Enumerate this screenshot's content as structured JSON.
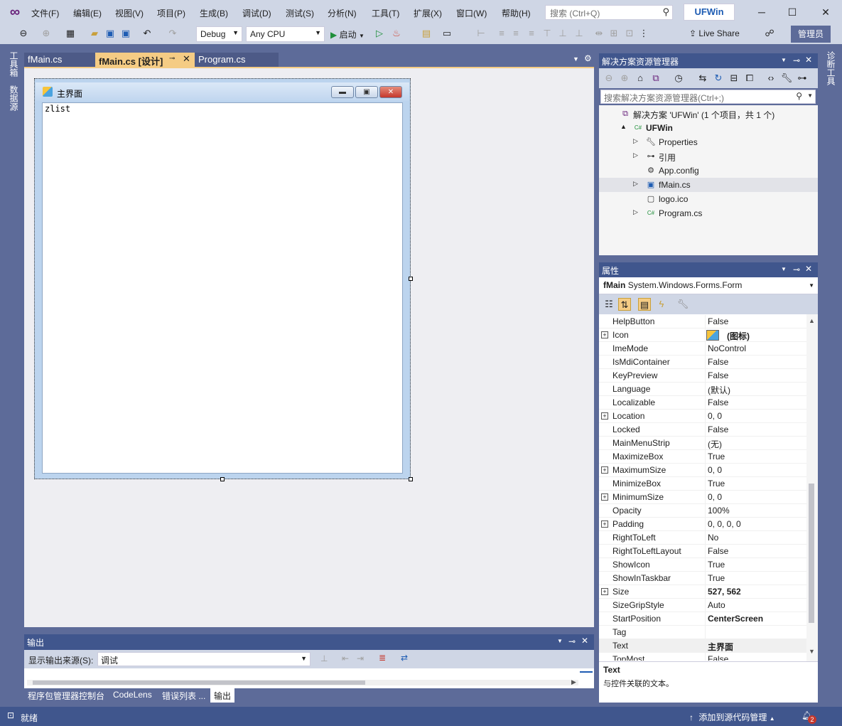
{
  "menu": {
    "items": [
      "文件(F)",
      "编辑(E)",
      "视图(V)",
      "项目(P)",
      "生成(B)",
      "调试(D)",
      "测试(S)",
      "分析(N)",
      "工具(T)",
      "扩展(X)",
      "窗口(W)",
      "帮助(H)"
    ],
    "search_placeholder": "搜索 (Ctrl+Q)",
    "app_title": "UFWin"
  },
  "toolbar": {
    "config": "Debug",
    "platform": "Any CPU",
    "start_label": "启动",
    "live_share": "Live Share",
    "admin": "管理员"
  },
  "left_rail": {
    "toolbox": "工具箱",
    "datasource": "数据源"
  },
  "right_rail": {
    "diagnostics": "诊断工具"
  },
  "doc_tabs": [
    {
      "label": "fMain.cs",
      "active": false
    },
    {
      "label": "fMain.cs [设计]",
      "active": true
    },
    {
      "label": "Program.cs",
      "active": false
    }
  ],
  "designer": {
    "form_title": "主界面",
    "control_text": "zlist"
  },
  "output": {
    "title": "输出",
    "source_label": "显示输出来源(S):",
    "source_value": "调试"
  },
  "bottom_tabs": [
    {
      "label": "程序包管理器控制台",
      "active": false
    },
    {
      "label": "CodeLens",
      "active": false
    },
    {
      "label": "错误列表 ...",
      "active": false
    },
    {
      "label": "输出",
      "active": true
    }
  ],
  "solution_explorer": {
    "title": "解决方案资源管理器",
    "search_placeholder": "搜索解决方案资源管理器(Ctrl+;)",
    "tree": [
      {
        "label": "解决方案 'UFWin' (1 个项目，共 1 个)",
        "indent": 0,
        "icon": "solution-icon",
        "expander": "",
        "bold": false
      },
      {
        "label": "UFWin",
        "indent": 1,
        "icon": "csharp-project-icon",
        "expander": "▲",
        "bold": true
      },
      {
        "label": "Properties",
        "indent": 2,
        "icon": "wrench-icon",
        "expander": "▷",
        "bold": false
      },
      {
        "label": "引用",
        "indent": 2,
        "icon": "references-icon",
        "expander": "▷",
        "bold": false
      },
      {
        "label": "App.config",
        "indent": 2,
        "icon": "config-file-icon",
        "expander": "",
        "bold": false
      },
      {
        "label": "fMain.cs",
        "indent": 2,
        "icon": "form-file-icon",
        "expander": "▷",
        "bold": false,
        "selected": true
      },
      {
        "label": "logo.ico",
        "indent": 2,
        "icon": "ico-file-icon",
        "expander": "",
        "bold": false
      },
      {
        "label": "Program.cs",
        "indent": 2,
        "icon": "csharp-file-icon",
        "expander": "▷",
        "bold": false
      }
    ]
  },
  "properties": {
    "title": "属性",
    "object_name": "fMain",
    "object_type": "System.Windows.Forms.Form",
    "rows": [
      {
        "name": "HelpButton",
        "value": "False"
      },
      {
        "name": "Icon",
        "value": "(图标)",
        "expandable": true,
        "bold": true
      },
      {
        "name": "ImeMode",
        "value": "NoControl"
      },
      {
        "name": "IsMdiContainer",
        "value": "False"
      },
      {
        "name": "KeyPreview",
        "value": "False"
      },
      {
        "name": "Language",
        "value": "(默认)"
      },
      {
        "name": "Localizable",
        "value": "False"
      },
      {
        "name": "Location",
        "value": "0, 0",
        "expandable": true
      },
      {
        "name": "Locked",
        "value": "False"
      },
      {
        "name": "MainMenuStrip",
        "value": "(无)"
      },
      {
        "name": "MaximizeBox",
        "value": "True"
      },
      {
        "name": "MaximumSize",
        "value": "0, 0",
        "expandable": true
      },
      {
        "name": "MinimizeBox",
        "value": "True"
      },
      {
        "name": "MinimumSize",
        "value": "0, 0",
        "expandable": true
      },
      {
        "name": "Opacity",
        "value": "100%"
      },
      {
        "name": "Padding",
        "value": "0, 0, 0, 0",
        "expandable": true
      },
      {
        "name": "RightToLeft",
        "value": "No"
      },
      {
        "name": "RightToLeftLayout",
        "value": "False"
      },
      {
        "name": "ShowIcon",
        "value": "True"
      },
      {
        "name": "ShowInTaskbar",
        "value": "True"
      },
      {
        "name": "Size",
        "value": "527, 562",
        "expandable": true,
        "bold": true
      },
      {
        "name": "SizeGripStyle",
        "value": "Auto"
      },
      {
        "name": "StartPosition",
        "value": "CenterScreen",
        "bold": true
      },
      {
        "name": "Tag",
        "value": ""
      },
      {
        "name": "Text",
        "value": "主界面",
        "bold": true,
        "selected": true
      },
      {
        "name": "TopMost",
        "value": "False"
      }
    ],
    "desc_title": "Text",
    "desc_text": "与控件关联的文本。"
  },
  "status": {
    "ready": "就绪",
    "source_control": "添加到源代码管理",
    "notifications": "2"
  },
  "colors": {
    "accent": "#5d6b99",
    "panel_header": "#40568d",
    "tab_active": "#f5cc84",
    "brand": "#68217a"
  }
}
